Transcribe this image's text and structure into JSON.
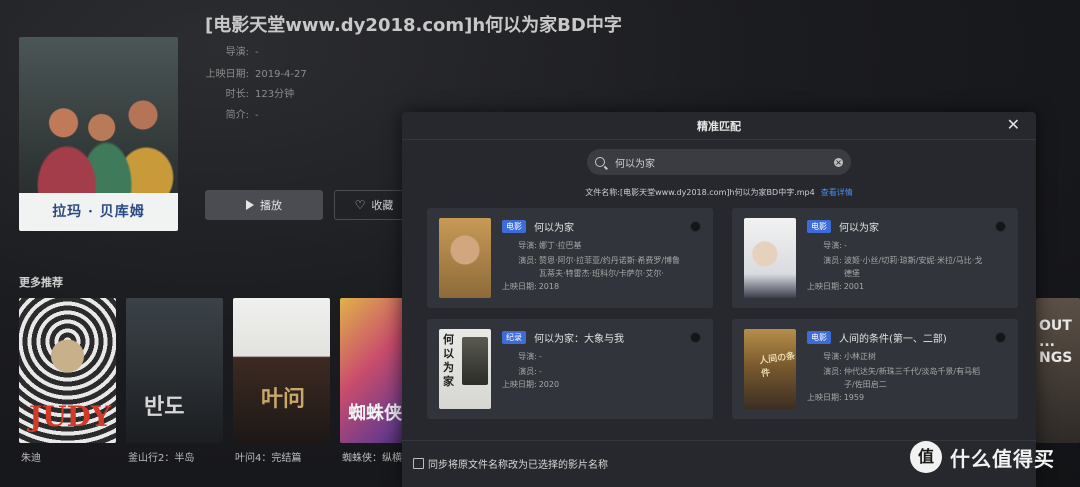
{
  "movie": {
    "title": "[电影天堂www.dy2018.com]h何以为家BD中字",
    "poster_caption": "拉玛 · 贝库姆",
    "director_label": "导演:",
    "director": "-",
    "release_label": "上映日期:",
    "release": "2019-4-27",
    "duration_label": "时长:",
    "duration": "123分钟",
    "intro_label": "简介:",
    "intro": "-",
    "play_label": "播放",
    "fav_label": "收藏"
  },
  "more": {
    "title": "更多推荐",
    "items": [
      {
        "label": "朱迪",
        "poster_text": "JUDY"
      },
      {
        "label": "釜山行2：半岛",
        "poster_text": "반도"
      },
      {
        "label": "叶问4：完结篇",
        "poster_text": "叶问"
      },
      {
        "label": "蜘蛛侠：纵横宇",
        "poster_text": "蜘蛛侠"
      },
      {
        "label": "",
        "poster_text": "OUT ... NGS"
      }
    ]
  },
  "modal": {
    "title": "精准匹配",
    "search_value": "何以为家",
    "filename_label": "文件名称:",
    "filename": "[电影天堂www.dy2018.com]h何以为家BD中字.mp4",
    "detail_link": "查看详情",
    "sync_label": "同步将原文件名称改为已选择的影片名称",
    "cards": [
      {
        "badge": "电影",
        "title": "何以为家",
        "director": "娜丁·拉巴基",
        "actors": "赞恩·阿尔·拉菲亚/约丹诺斯·希费罗/博鲁瓦蒂夫·特雷杰·班科尔/卡萨尔·艾尔·",
        "date": "2018",
        "thumb_text": ""
      },
      {
        "badge": "电影",
        "title": "何以为家",
        "director": "-",
        "actors": "波姬·小丝/切莉·琼斯/安妮·米拉/马比·戈德堡",
        "date": "2001",
        "thumb_text": ""
      },
      {
        "badge": "纪录",
        "title": "何以为家：大象与我",
        "director": "-",
        "actors": "-",
        "date": "2020",
        "thumb_text": "何以为家"
      },
      {
        "badge": "电影",
        "title": "人间的条件(第一、二部)",
        "director": "小林正树",
        "actors": "仲代达矢/新珠三千代/淡岛千景/有马稻子/佐田启二",
        "date": "1959",
        "thumb_text": "人间の条件"
      }
    ],
    "labels": {
      "director": "导演:",
      "actors": "演员:",
      "date": "上映日期:"
    }
  },
  "watermark": {
    "logo": "值",
    "text": "什么值得买"
  }
}
